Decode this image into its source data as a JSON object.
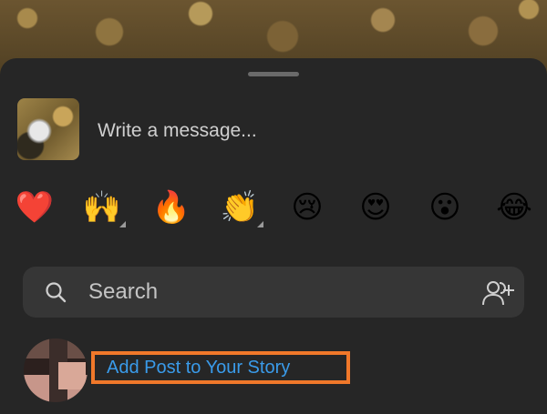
{
  "message": {
    "placeholder": "Write a message..."
  },
  "reactions": [
    {
      "glyph": "❤️",
      "icon": "red-heart",
      "has_variants": false
    },
    {
      "glyph": "🙌",
      "icon": "raising-hands",
      "has_variants": true
    },
    {
      "glyph": "🔥",
      "icon": "fire",
      "has_variants": false
    },
    {
      "glyph": "👏",
      "icon": "clapping-hands",
      "has_variants": true
    },
    {
      "glyph": "😢",
      "icon": "crying-face",
      "has_variants": false
    },
    {
      "glyph": "😍",
      "icon": "heart-eyes-face",
      "has_variants": false
    },
    {
      "glyph": "😮",
      "icon": "surprised-face",
      "has_variants": false
    },
    {
      "glyph": "😂",
      "icon": "tears-of-joy-face",
      "has_variants": false
    }
  ],
  "search": {
    "placeholder": "Search"
  },
  "story": {
    "label": "Add Post to Your Story"
  },
  "colors": {
    "sheet": "#262626",
    "search_bg": "#363636",
    "link": "#3a9bea",
    "highlight": "#f0782a"
  }
}
